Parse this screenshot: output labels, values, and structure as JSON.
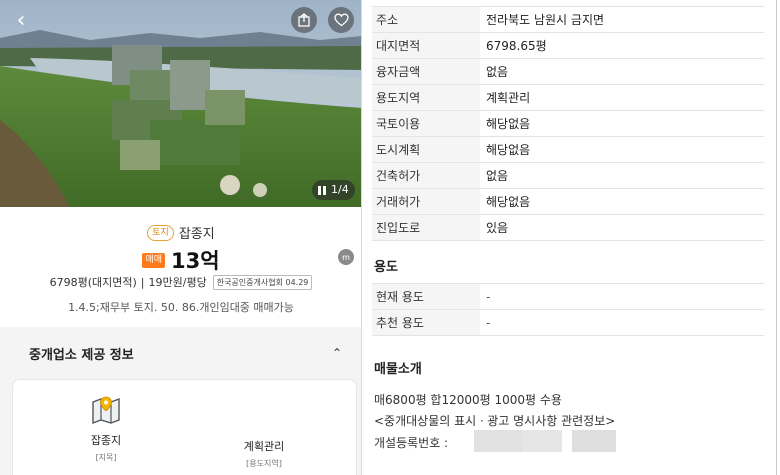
{
  "photo": {
    "counter": "1/4",
    "icons": [
      "chevron-left-icon",
      "share-icon",
      "heart-icon",
      "gallery-icon"
    ]
  },
  "summary": {
    "type_badge": "토지",
    "type": "잡종지",
    "deal_badge": "매매",
    "price": "13억",
    "area_text": "6798평(대지면적)",
    "separator": "|",
    "unit_price": "19만원/평당",
    "assoc_badge": "한국공인중개사협회 04.29",
    "description": "1.4.5;재무부 토지. 50. 86.개인임대중 매매가능",
    "side_icon": "m"
  },
  "broker_section": {
    "title": "중개업소 제공 정보",
    "chevron": "⌃",
    "items": [
      {
        "icon": "map-pin-icon",
        "main": "잡종지",
        "sub": "[지목]"
      },
      {
        "main": "계획관리",
        "sub": "[용도지역]"
      }
    ]
  },
  "info_table": [
    {
      "key": "주소",
      "value": "전라북도 남원시 금지면"
    },
    {
      "key": "대지면적",
      "value": "6798.65평"
    },
    {
      "key": "융자금액",
      "value": "없음"
    },
    {
      "key": "용도지역",
      "value": "계획관리"
    },
    {
      "key": "국토이용",
      "value": "해당없음"
    },
    {
      "key": "도시계획",
      "value": "해당없음"
    },
    {
      "key": "건축허가",
      "value": "없음"
    },
    {
      "key": "거래허가",
      "value": "해당없음"
    },
    {
      "key": "진입도로",
      "value": "있음"
    }
  ],
  "use_section": {
    "title": "용도",
    "rows": [
      {
        "key": "현재 용도",
        "value": "-"
      },
      {
        "key": "추천 용도",
        "value": "-"
      }
    ]
  },
  "intro_section": {
    "title": "매물소개",
    "lines": [
      "매6800평 합12000평 1000평 수용",
      "<중개대상물의 표시ㆍ광고 명시사항 관련정보>",
      "개설등록번호 :"
    ]
  }
}
